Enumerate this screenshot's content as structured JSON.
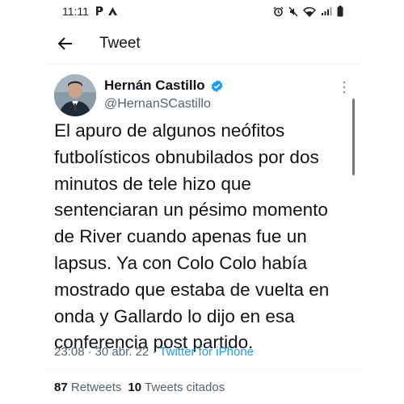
{
  "status_bar": {
    "time": "11:11",
    "left_icons": [
      "p-app-icon",
      "a-app-icon"
    ],
    "right_icons": [
      "alarm-icon",
      "mute-icon",
      "wifi-icon",
      "signal-icon",
      "battery-icon"
    ]
  },
  "app_bar": {
    "back_icon": "back-arrow-icon",
    "title": "Tweet"
  },
  "tweet": {
    "author_name": "Hernán Castillo",
    "verified": true,
    "handle": "@HernanSCastillo",
    "text": "El apuro de algunos neófitos\nfutbolísticos obnubilados por dos\nminutos de tele hizo que\nsentenciaran un pésimo momento\nde River cuando apenas fue un\nlapsus. Ya con Colo Colo había\nmostrado que estaba de vuelta en\nonda y Gallardo lo dijo en esa\nconferencia post partido.",
    "time": "23:08",
    "separator": "·",
    "date": "30 abr. 22",
    "source": "Twitter for iPhone",
    "stats": {
      "retweets_count": "87",
      "retweets_label": "Retweets",
      "quotes_count": "10",
      "quotes_label": "Tweets citados"
    }
  },
  "colors": {
    "accent": "#1d9bf0",
    "text": "#0f1419",
    "secondary": "#536471"
  }
}
